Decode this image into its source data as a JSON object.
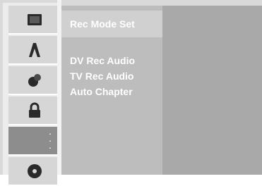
{
  "sidebar": {
    "items": [
      {
        "icon": "screen-icon"
      },
      {
        "icon": "language-icon"
      },
      {
        "icon": "audio-icon"
      },
      {
        "icon": "lock-icon"
      },
      {
        "icon": "more-icon",
        "active": true
      },
      {
        "icon": "disc-icon"
      }
    ]
  },
  "menu": {
    "items": [
      {
        "label": "Rec Mode Set"
      },
      {
        "label": "DV Rec Audio"
      },
      {
        "label": "TV Rec Audio"
      },
      {
        "label": "Auto Chapter"
      }
    ]
  },
  "colors": {
    "background": "#d9d9d9",
    "sidebar": "#ececec",
    "menu": "#bdbdbd",
    "menu_selected": "#d0d0d0",
    "detail": "#a9a9a9",
    "active_tab": "#8d8d8d"
  }
}
